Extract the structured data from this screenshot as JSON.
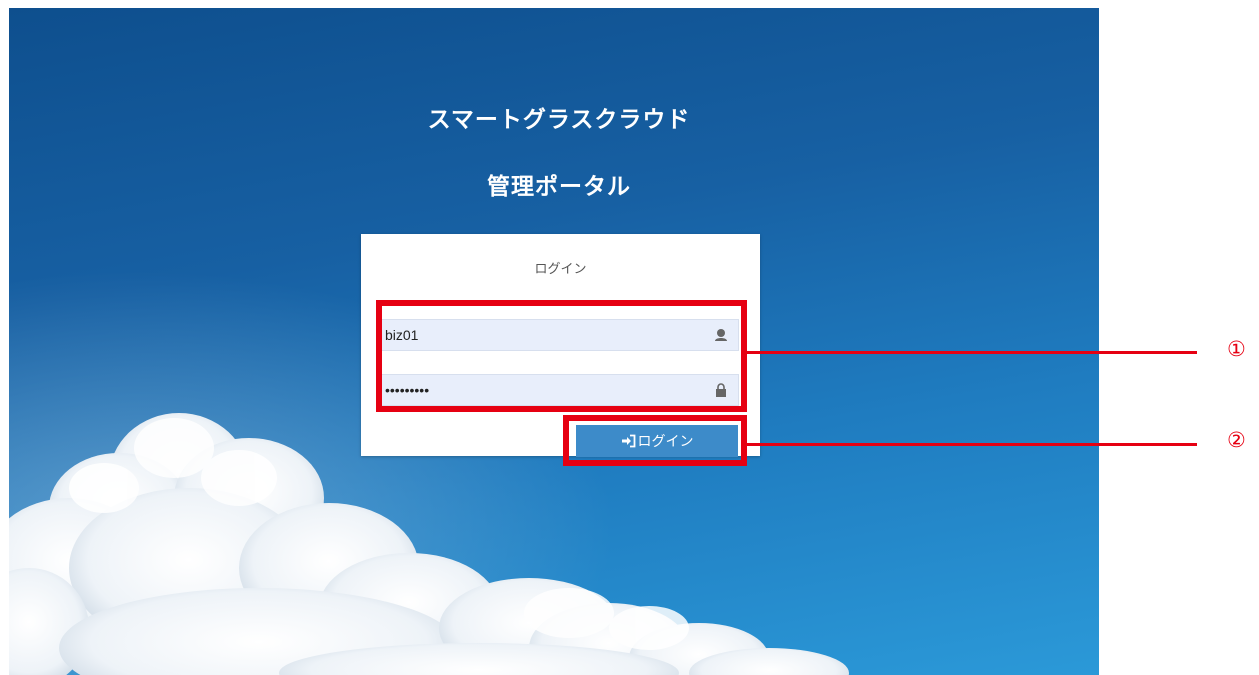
{
  "header": {
    "title": "スマートグラスクラウド",
    "subtitle": "管理ポータル"
  },
  "login_panel": {
    "heading": "ログイン",
    "username": {
      "value": "biz01",
      "icon": "user-icon"
    },
    "password": {
      "value": "passwords",
      "icon": "lock-icon"
    },
    "submit": {
      "label": "ログイン",
      "icon": "sign-in-icon"
    }
  },
  "annotations": {
    "marker_1": "①",
    "marker_2": "②"
  },
  "colors": {
    "highlight": "#e60012",
    "button": "#3d8bc9",
    "field_bg": "#e8eefb",
    "sky_dark": "#0e4f8e",
    "sky_light": "#2b99d8"
  }
}
